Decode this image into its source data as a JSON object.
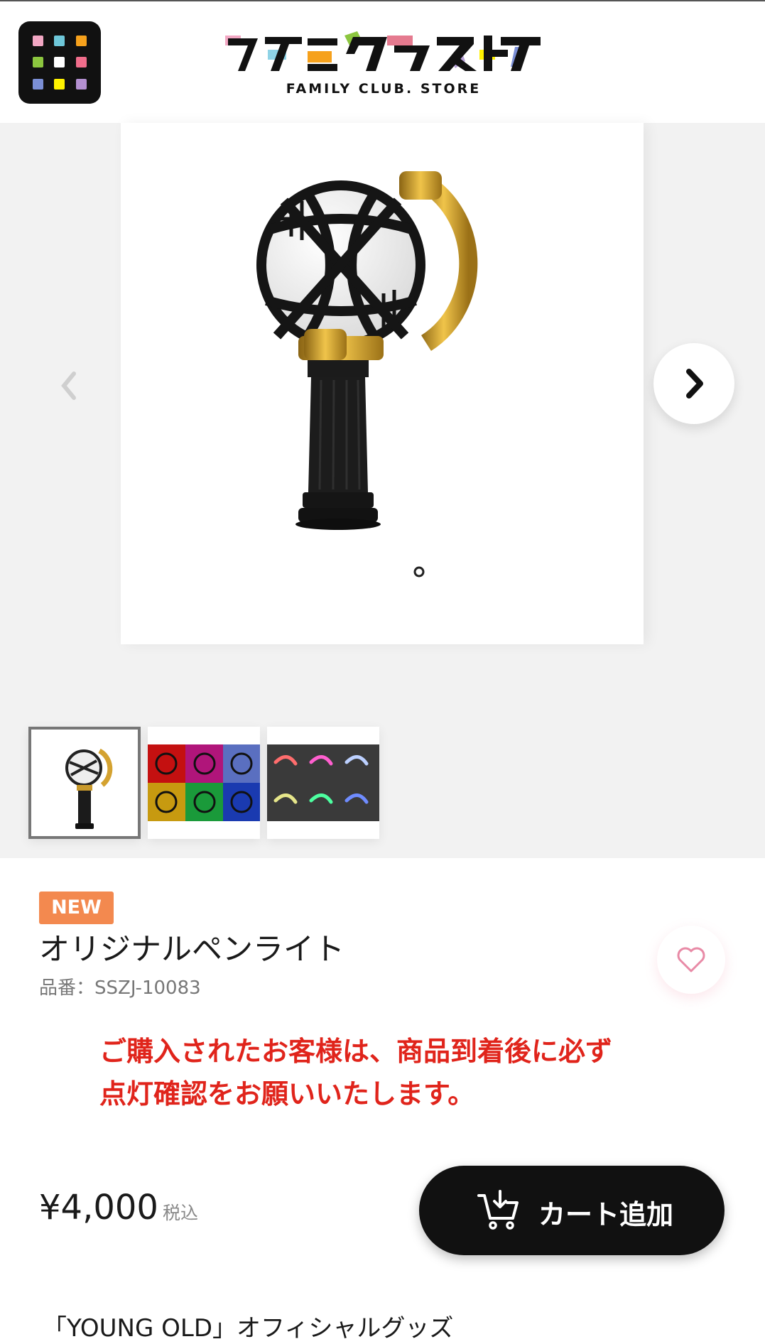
{
  "header": {
    "menu_icon": "app-grid-icon",
    "logo_text": "ファミクラストア",
    "logo_subtitle": "FAMILY CLUB. STORE",
    "menu_dot_colors": [
      "#f2a7c3",
      "#6ec7d9",
      "#f6a11c",
      "#8cc63f",
      "#ffffff",
      "#f06d8b",
      "#7b8fd6",
      "#fff200",
      "#b38fd0"
    ]
  },
  "gallery": {
    "main_image_alt": "penlight-product-image",
    "prev_icon": "chevron-left-icon",
    "next_icon": "chevron-right-icon",
    "thumbnails": [
      {
        "name": "thumb-penlight-front",
        "active": true
      },
      {
        "name": "thumb-penlight-colors",
        "active": false
      },
      {
        "name": "thumb-penlight-glow",
        "active": false
      }
    ]
  },
  "product": {
    "badge": "NEW",
    "title": "オリジナルペンライト",
    "sku": "品番：SSZJ-10083",
    "favorite_icon": "heart-icon",
    "notice_line1": "ご購入されたお客様は、商品到着後に必ず",
    "notice_line2": "点灯確認をお願いいたします。",
    "price": "¥4,000",
    "tax_label": "税込",
    "cart_label": "カート追加",
    "cart_icon": "cart-add-icon",
    "series_text": "「YOUNG OLD」オフィシャルグッズ"
  },
  "colors": {
    "badge": "#f3894f",
    "notice": "#e0241b",
    "cart_button": "#111111",
    "heart": "#e88aa6"
  }
}
